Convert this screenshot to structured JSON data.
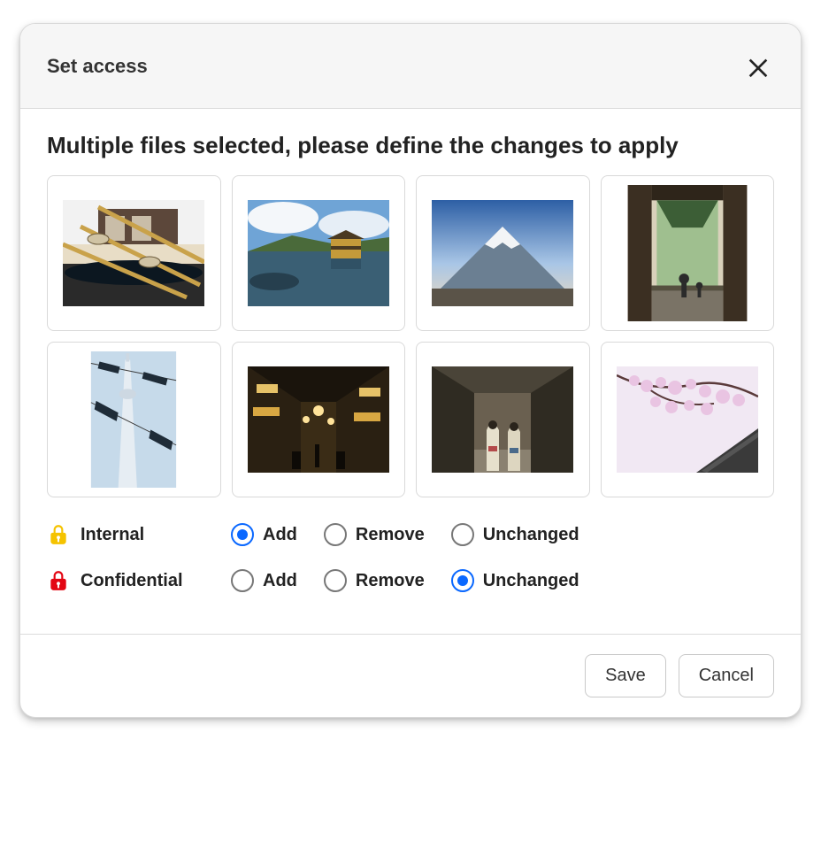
{
  "dialog": {
    "title": "Set access",
    "subtitle": "Multiple files selected, please define the changes to apply",
    "close_icon": "close-icon"
  },
  "thumbnails": [
    {
      "name": "thumb-water-ladles"
    },
    {
      "name": "thumb-golden-pavilion"
    },
    {
      "name": "thumb-mt-fuji"
    },
    {
      "name": "thumb-temple-gate"
    },
    {
      "name": "thumb-skytree-koinobori"
    },
    {
      "name": "thumb-night-alley"
    },
    {
      "name": "thumb-kimono-street"
    },
    {
      "name": "thumb-cherry-blossom"
    }
  ],
  "access_levels": [
    {
      "id": "internal",
      "label": "Internal",
      "lock_color": "#f5c300",
      "selected": "add"
    },
    {
      "id": "confidential",
      "label": "Confidential",
      "lock_color": "#e30613",
      "selected": "unchanged"
    }
  ],
  "radio_options": [
    {
      "id": "add",
      "label": "Add"
    },
    {
      "id": "remove",
      "label": "Remove"
    },
    {
      "id": "unchanged",
      "label": "Unchanged"
    }
  ],
  "footer": {
    "save_label": "Save",
    "cancel_label": "Cancel"
  }
}
